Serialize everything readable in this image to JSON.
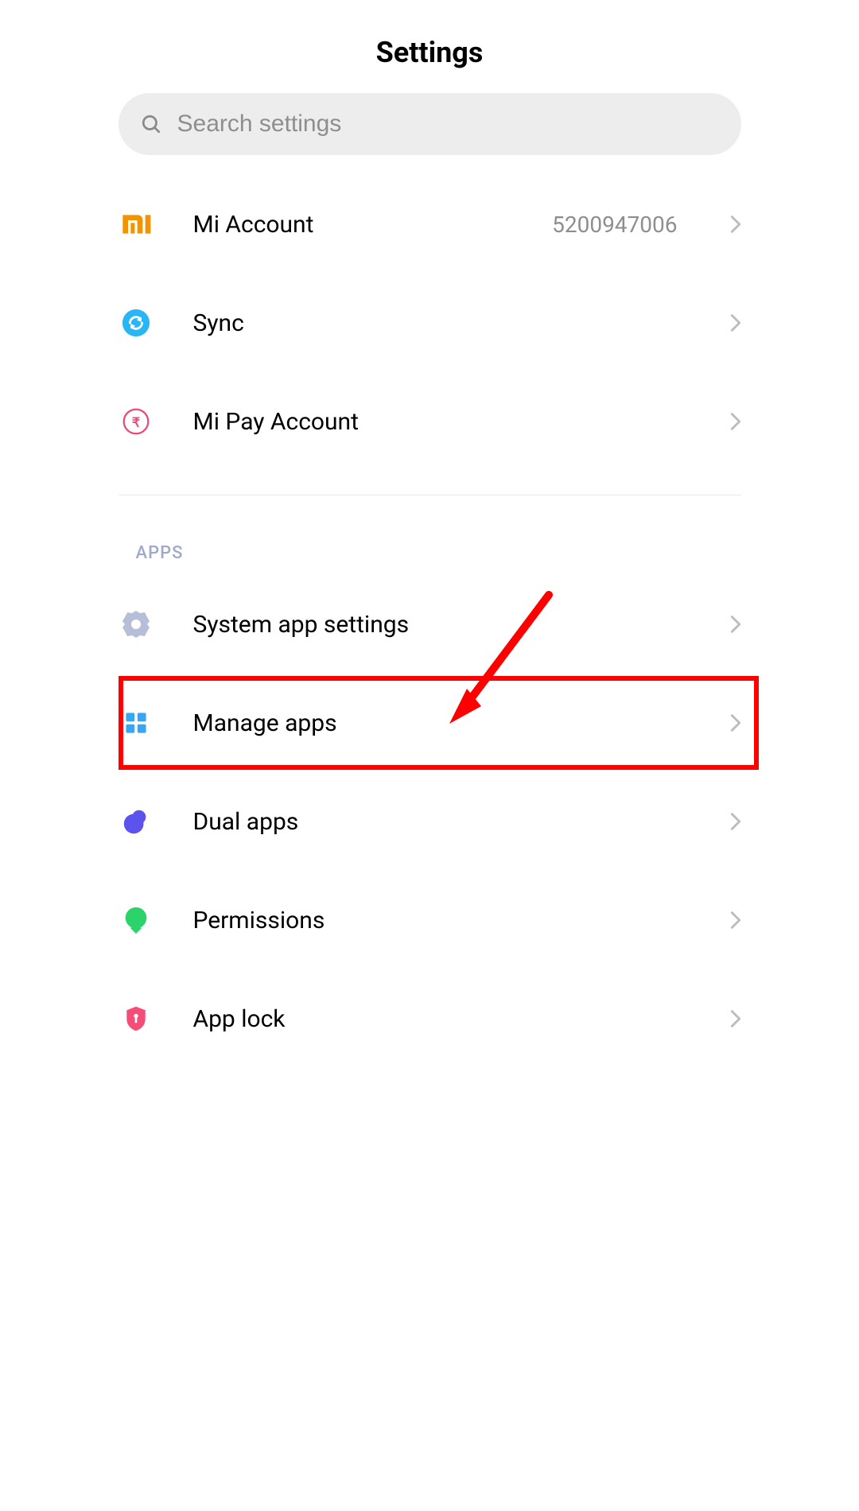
{
  "header": {
    "title": "Settings"
  },
  "search": {
    "placeholder": "Search settings"
  },
  "account_section": {
    "mi_account": {
      "label": "Mi Account",
      "value": "5200947006"
    },
    "sync": {
      "label": "Sync"
    },
    "mi_pay": {
      "label": "Mi Pay Account"
    }
  },
  "apps_section": {
    "header": "APPS",
    "system_app_settings": {
      "label": "System app settings"
    },
    "manage_apps": {
      "label": "Manage apps"
    },
    "dual_apps": {
      "label": "Dual apps"
    },
    "permissions": {
      "label": "Permissions"
    },
    "app_lock": {
      "label": "App lock"
    }
  },
  "colors": {
    "mi_orange": "#f39c12",
    "sync_blue": "#29b6f6",
    "rupee_pink": "#e84b7a",
    "gear_grey": "#b7bed7",
    "grid_blue": "#39a6f3",
    "dual_purple": "#5c52ee",
    "perm_green": "#2bd36a",
    "lock_pink": "#f34d78",
    "highlight_red": "#ff0000"
  }
}
